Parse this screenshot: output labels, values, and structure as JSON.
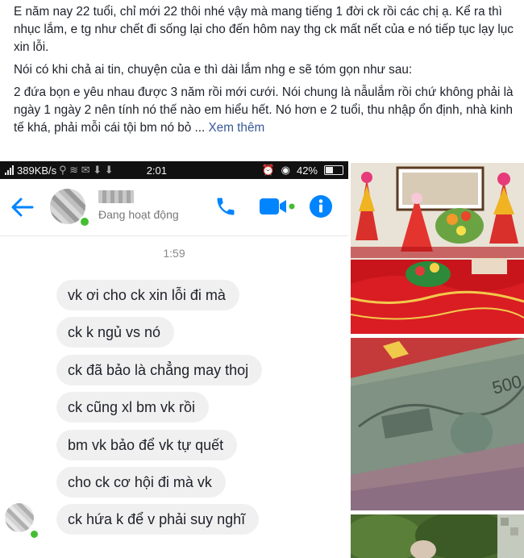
{
  "post": {
    "paragraphs": [
      "E năm nay 22 tuổi, chỉ mới 22 thôi nhé vậy mà mang tiếng 1 đời ck rồi các chị ạ. Kể ra thì nhục lắm, e tg như chết đi sống lại cho đến hôm nay thg ck mất nết của e nó tiếp tục lạy lục xin lỗi.",
      "Nói có khi chả ai tin, chuyện của e thì dài lắm nhg e sẽ tóm gọn như sau:"
    ],
    "last_paragraph": "2 đứa bọn e yêu nhau được 3 năm rồi mới cưới. Nói chung là nẫulắm rồi chứ không phải là ngày 1 ngày 2 nên tính nó thế nào em hiểu hết. Nó hơn e 2 tuổi, thu nhập ổn định, nhà kinh tế khá, phải mỗi cái tội bm nó bỏ ...",
    "see_more": "Xem thêm"
  },
  "status_bar": {
    "speed": "389KB/s",
    "time": "2:01",
    "battery": "42%"
  },
  "chat_header": {
    "contact_status": "Đang hoạt động",
    "icons": [
      "back-arrow-icon",
      "phone-icon",
      "video-icon",
      "info-icon"
    ],
    "accent_color": "#0084ff"
  },
  "chat": {
    "timestamp": "1:59",
    "messages": [
      "vk ơi cho ck xin lỗi đi mà",
      "ck k ngủ vs nó",
      "ck đã bảo là chẳng may thoj",
      "ck cũng xl bm vk rồi",
      "bm vk bảo để vk tự quết",
      "cho ck cơ hội đi mà vk",
      "ck hứa k để v phải suy nghĩ"
    ]
  },
  "photos": [
    "wedding-tray-photo",
    "money-banknotes-photo",
    "outdoor-photo"
  ]
}
